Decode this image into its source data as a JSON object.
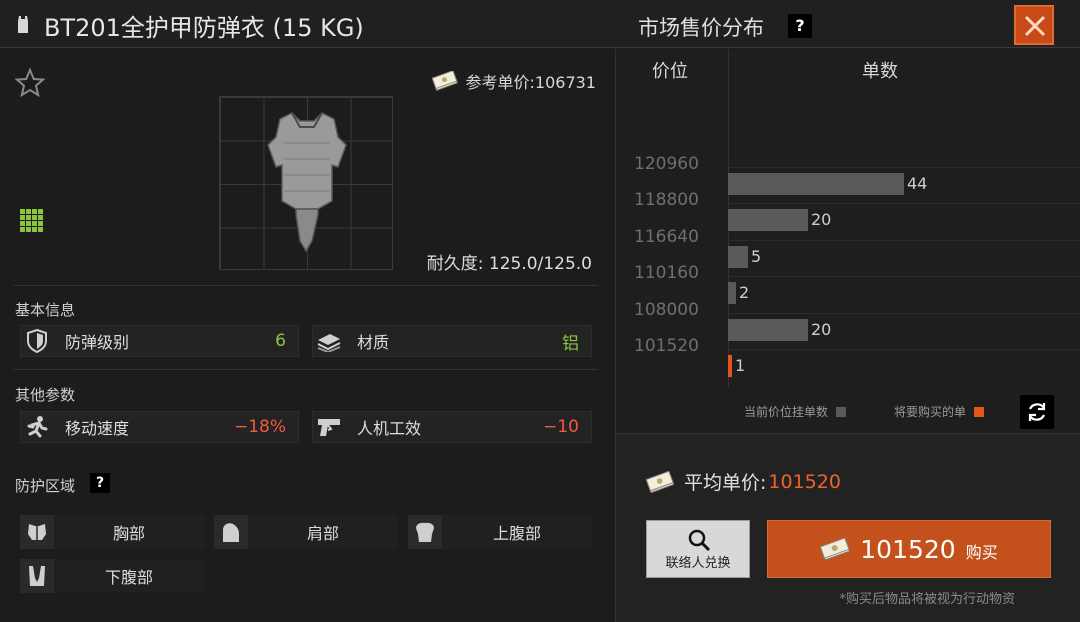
{
  "header": {
    "item_title": "BT201全护甲防弹衣 (15 KG)",
    "market_title": "市场售价分布",
    "help_mark": "?"
  },
  "item": {
    "ref_price_label": "参考单价:106731",
    "durability": "耐久度: 125.0/125.0"
  },
  "basic_info": {
    "section_title": "基本信息",
    "stats": [
      {
        "label": "防弹级别",
        "value": "6",
        "icon": "shield-icon"
      },
      {
        "label": "材质",
        "value": "铝",
        "icon": "material-icon"
      }
    ]
  },
  "other_params": {
    "section_title": "其他参数",
    "stats": [
      {
        "label": "移动速度",
        "value": "−18%",
        "icon": "runner-icon"
      },
      {
        "label": "人机工效",
        "value": "−10",
        "icon": "pistol-icon"
      }
    ]
  },
  "protection": {
    "section_title": "防护区域",
    "help_mark": "?",
    "zones": [
      {
        "label": "胸部",
        "icon": "chest-icon"
      },
      {
        "label": "肩部",
        "icon": "shoulder-icon"
      },
      {
        "label": "上腹部",
        "icon": "upper-abdomen-icon"
      },
      {
        "label": "下腹部",
        "icon": "lower-abdomen-icon"
      }
    ]
  },
  "market": {
    "col_price": "价位",
    "col_count": "单数",
    "legend_current": "当前价位挂单数",
    "legend_buy": "将要购买的单",
    "avg_label": "平均单价:",
    "avg_value": "101520",
    "contact_label": "联络人兑换",
    "buy_amount": "101520",
    "buy_label": "购买",
    "note": "*购买后物品将被视为行动物资"
  },
  "colors": {
    "accent": "#c4501c",
    "bar": "#5a5a5a",
    "buy_bar": "#e4551c",
    "positive": "#8cc63f",
    "negative": "#f05a3c"
  },
  "chart_data": {
    "type": "bar",
    "orientation": "horizontal",
    "categories": [
      "120960",
      "118800",
      "116640",
      "110160",
      "108000",
      "101520"
    ],
    "series": [
      {
        "name": "当前价位挂单数",
        "values": [
          44,
          20,
          5,
          2,
          20,
          0
        ]
      },
      {
        "name": "将要购买的单",
        "values": [
          0,
          0,
          0,
          0,
          0,
          1
        ]
      }
    ],
    "labels": [
      "44",
      "20",
      "5",
      "2",
      "20",
      "1"
    ],
    "xlabel": "单数",
    "ylabel": "价位"
  }
}
